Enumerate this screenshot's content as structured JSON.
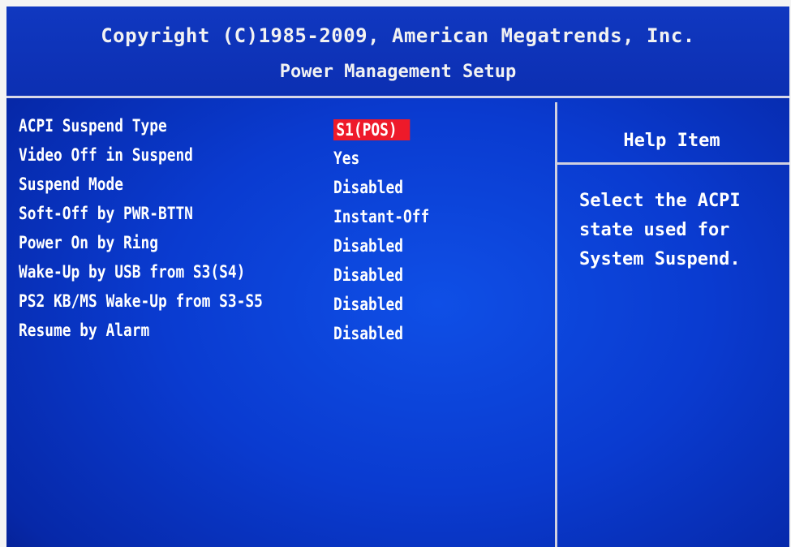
{
  "header": {
    "copyright": "Copyright (C)1985-2009, American Megatrends, Inc.",
    "title": "Power Management Setup"
  },
  "settings": [
    {
      "label": "ACPI Suspend Type",
      "value": "S1(POS)",
      "selected": true
    },
    {
      "label": "Video Off in Suspend",
      "value": "Yes"
    },
    {
      "label": "Suspend Mode",
      "value": "Disabled"
    },
    {
      "label": "Soft-Off by PWR-BTTN",
      "value": "Instant-Off"
    },
    {
      "label": "Power On by Ring",
      "value": "Disabled"
    },
    {
      "label": "Wake-Up by USB from S3(S4)",
      "value": "Disabled"
    },
    {
      "label": "PS2 KB/MS Wake-Up from S3-S5",
      "value": "Disabled"
    },
    {
      "label": "Resume by Alarm",
      "value": "Disabled"
    }
  ],
  "help": {
    "title": "Help Item",
    "lines": [
      "Select the ACPI",
      "state used for",
      "System Suspend."
    ]
  },
  "colors": {
    "background": "#0a3bd0",
    "selection": "#ee1a2a",
    "text": "#ffffff"
  }
}
